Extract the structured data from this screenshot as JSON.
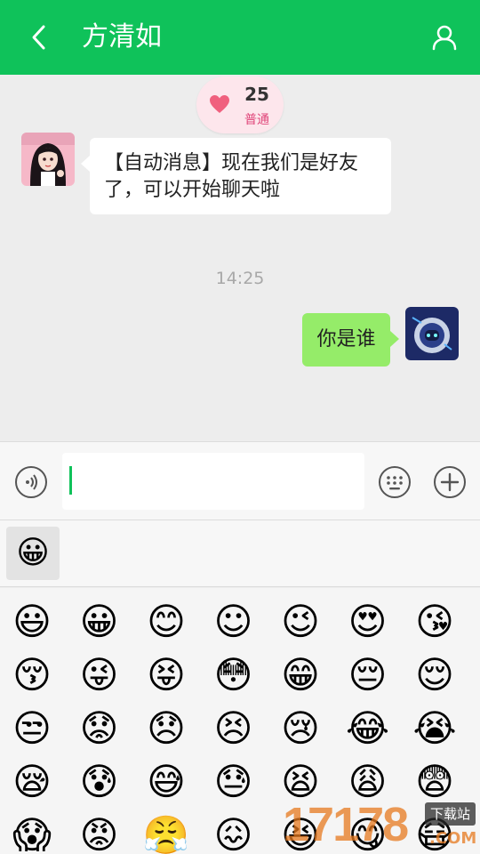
{
  "header": {
    "title": "方清如",
    "back_icon": "back-chevron-icon",
    "user_icon": "user-profile-icon",
    "bg_color": "#0fc25a"
  },
  "intimacy": {
    "score": "25",
    "level": "普通",
    "icon": "heart-icon"
  },
  "messages": [
    {
      "side": "left",
      "text": "【自动消息】现在我们是好友了，可以开始聊天啦",
      "bubble_color": "#ffffff"
    },
    {
      "timestamp": "14:25"
    },
    {
      "side": "right",
      "text": "你是谁",
      "bubble_color": "#95ec69"
    }
  ],
  "input": {
    "value": "",
    "voice_icon": "voice-icon",
    "emoji_icon": "emoji-keyboard-icon",
    "plus_icon": "plus-icon"
  },
  "emoji_panel": {
    "selected_tab": "😀",
    "emojis": [
      "😃",
      "😀",
      "😊",
      "☺",
      "😉",
      "😍",
      "😘",
      "😚",
      "😜",
      "😝",
      "😳",
      "😁",
      "😔",
      "😌",
      "😒",
      "😟",
      "😞",
      "😣",
      "😢",
      "😂",
      "😭",
      "😪",
      "😰",
      "😅",
      "😓",
      "😫",
      "😩",
      "😨",
      "😱",
      "😡",
      "😤",
      "😖",
      "😆",
      "😋",
      "😷"
    ]
  },
  "watermark": {
    "number": "17178",
    "tag": "下载站",
    "suffix": ".COM"
  }
}
